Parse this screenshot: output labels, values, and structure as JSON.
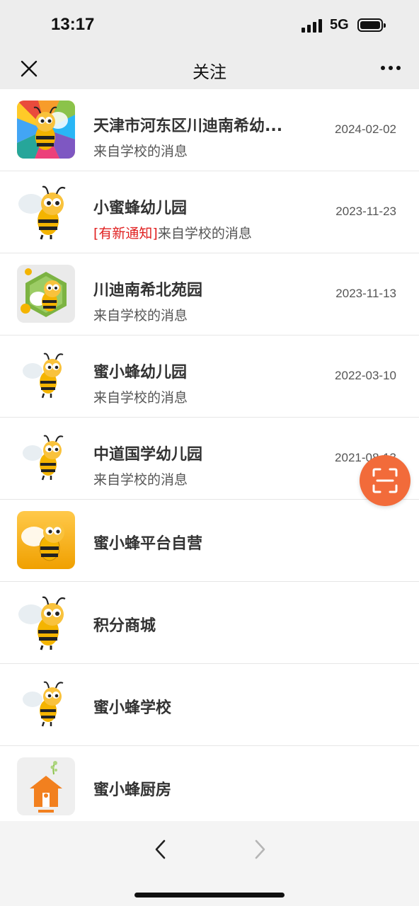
{
  "status_bar": {
    "time": "13:17",
    "network": "5G"
  },
  "nav": {
    "title": "关注"
  },
  "items": [
    {
      "title": "天津市河东区川迪南希幼...",
      "subtitle": "来自学校的消息",
      "date": "2024-02-02",
      "icon": "bee-rainbow-icon"
    },
    {
      "title": "小蜜蜂幼儿园",
      "subtitle_tag": "[有新通知]",
      "subtitle": "来自学校的消息",
      "date": "2023-11-23",
      "icon": "bee-icon"
    },
    {
      "title": "川迪南希北苑园",
      "subtitle": "来自学校的消息",
      "date": "2023-11-13",
      "icon": "bee-hexagon-icon"
    },
    {
      "title": "蜜小蜂幼儿园",
      "subtitle": "来自学校的消息",
      "date": "2022-03-10",
      "icon": "bee-icon"
    },
    {
      "title": "中道国学幼儿园",
      "subtitle": "来自学校的消息",
      "date": "2021-08-13",
      "icon": "bee-icon"
    },
    {
      "title": "蜜小蜂平台自营",
      "icon": "bee-orange-tile-icon"
    },
    {
      "title": "积分商城",
      "icon": "bee-icon"
    },
    {
      "title": "蜜小蜂学校",
      "icon": "bee-icon"
    },
    {
      "title": "蜜小蜂厨房",
      "icon": "kitchen-house-icon"
    }
  ],
  "colors": {
    "accent": "#f26b3a",
    "tag_red": "#e02020"
  }
}
